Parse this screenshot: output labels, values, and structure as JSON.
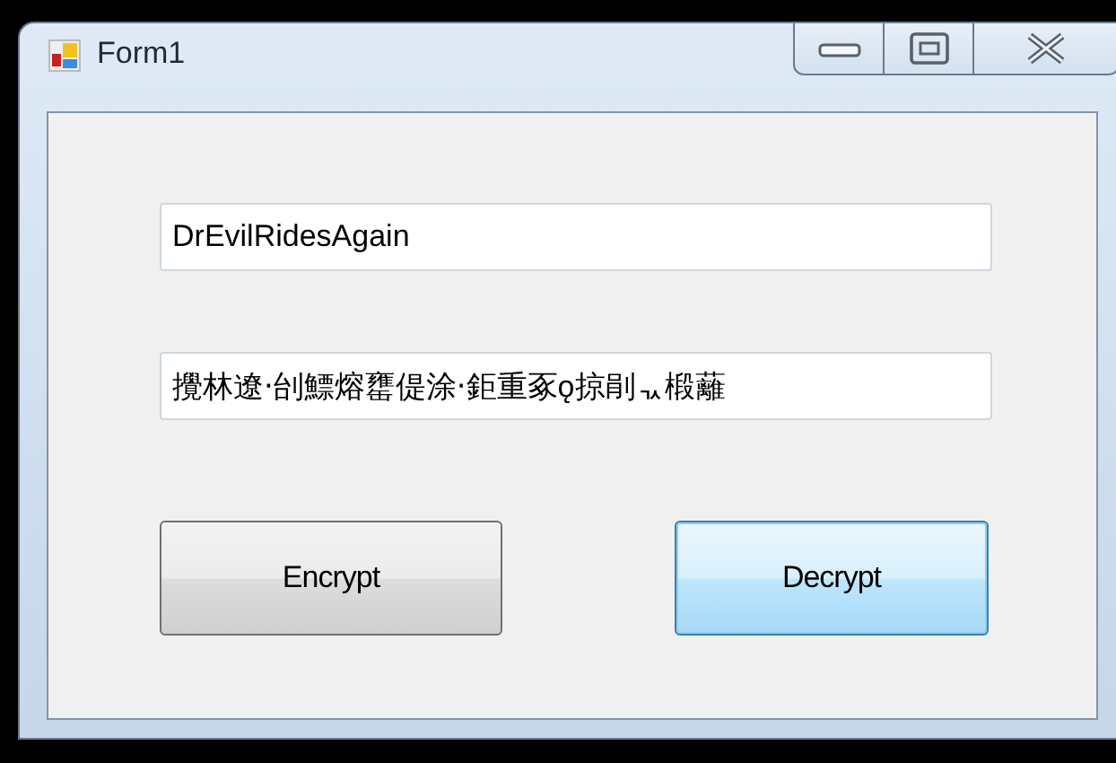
{
  "window": {
    "title": "Form1"
  },
  "fields": [
    {
      "value": "DrEvilRidesAgain"
    },
    {
      "value": "攪林遼‧刣鰾熔罋偍涂‧鉅重豖ǫ掠剈ᆪ椴蘺"
    }
  ],
  "buttons": [
    {
      "label": "Encrypt",
      "focused": false
    },
    {
      "label": "Decrypt",
      "focused": true
    }
  ]
}
